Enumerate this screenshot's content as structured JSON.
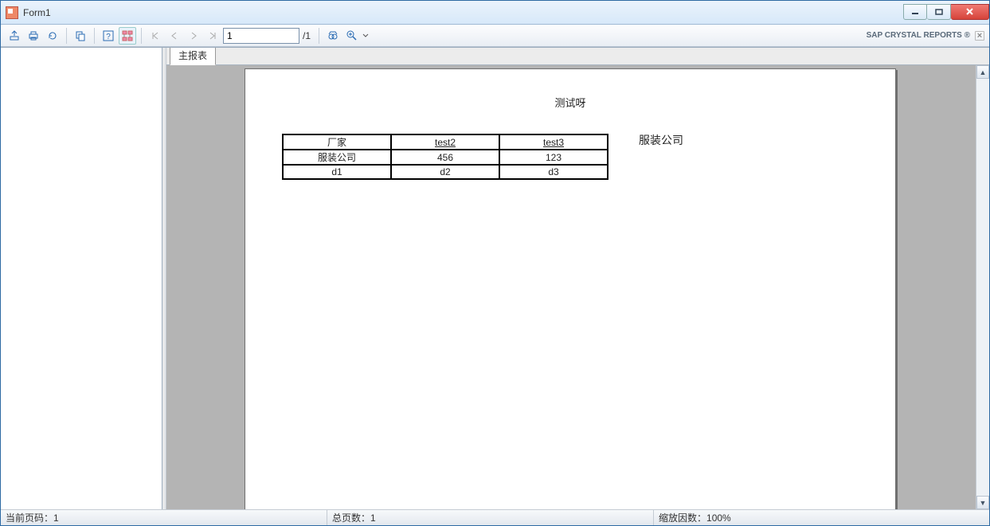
{
  "window": {
    "title": "Form1"
  },
  "toolbar": {
    "page_value": "1",
    "page_total": "/1"
  },
  "branding": {
    "text": "SAP CRYSTAL REPORTS ®"
  },
  "tabs": {
    "main": "主报表"
  },
  "report": {
    "title": "测试呀",
    "side_label": "服装公司",
    "table": {
      "headers": [
        "厂家",
        "test2",
        "test3"
      ],
      "rows": [
        [
          "服装公司",
          "456",
          "123"
        ],
        [
          "d1",
          "d2",
          "d3"
        ]
      ]
    }
  },
  "statusbar": {
    "current_page_label": "当前页码：",
    "current_page_value": "1",
    "total_pages_label": "总页数：",
    "total_pages_value": "1",
    "zoom_label": "缩放因数：",
    "zoom_value": "100%"
  }
}
